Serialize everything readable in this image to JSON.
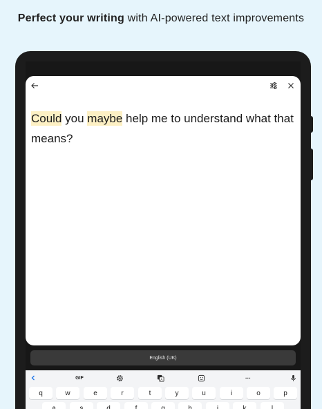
{
  "headline": {
    "bold": "Perfect your writing",
    "rest": " with AI-powered text improvements"
  },
  "editor": {
    "words": {
      "w1": "Could",
      "s1": " you ",
      "w2": "maybe",
      "s2": " help me to understand what that means?"
    },
    "highlight_color": "#fdf0c4"
  },
  "keyboard": {
    "language": "English (UK)",
    "toolbar": {
      "gif": "GIF",
      "more": "···"
    },
    "row1": [
      "q",
      "w",
      "e",
      "r",
      "t",
      "y",
      "u",
      "i",
      "o",
      "p"
    ],
    "row2": [
      "a",
      "s",
      "d",
      "f",
      "g",
      "h",
      "j",
      "k",
      "l"
    ]
  },
  "colors": {
    "page_bg": "#e6f5fc",
    "device": "#1c1c1c"
  }
}
